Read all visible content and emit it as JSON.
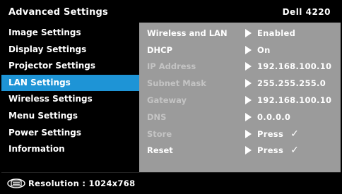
{
  "header": {
    "title": "Advanced Settings",
    "model": "Dell 4220"
  },
  "menu": {
    "items": [
      {
        "label": "Image Settings",
        "selected": false
      },
      {
        "label": "Display Settings",
        "selected": false
      },
      {
        "label": "Projector Settings",
        "selected": false
      },
      {
        "label": "LAN Settings",
        "selected": true
      },
      {
        "label": "Wireless Settings",
        "selected": false
      },
      {
        "label": "Menu Settings",
        "selected": false
      },
      {
        "label": "Power Settings",
        "selected": false
      },
      {
        "label": "Information",
        "selected": false
      }
    ]
  },
  "lan": {
    "rows": [
      {
        "label": "Wireless and LAN",
        "value": "Enabled",
        "enabled": true,
        "check": false
      },
      {
        "label": "DHCP",
        "value": "On",
        "enabled": true,
        "check": false
      },
      {
        "label": "IP Address",
        "value": "192.168.100.10",
        "enabled": false,
        "check": false
      },
      {
        "label": "Subnet Mask",
        "value": "255.255.255.0",
        "enabled": false,
        "check": false
      },
      {
        "label": "Gateway",
        "value": "192.168.100.10",
        "enabled": false,
        "check": false
      },
      {
        "label": "DNS",
        "value": "0.0.0.0",
        "enabled": false,
        "check": false
      },
      {
        "label": "Store",
        "value": "Press",
        "enabled": false,
        "check": true
      },
      {
        "label": "Reset",
        "value": "Press",
        "enabled": true,
        "check": true
      }
    ],
    "check_glyph": "✓"
  },
  "footer": {
    "icon": "monitor-icon",
    "resolution": "Resolution : 1024x768"
  },
  "colors": {
    "selected": "#1e94d6",
    "panel": "#9b9b9b",
    "background": "#000000",
    "dim_text": "#c4c4c4"
  }
}
